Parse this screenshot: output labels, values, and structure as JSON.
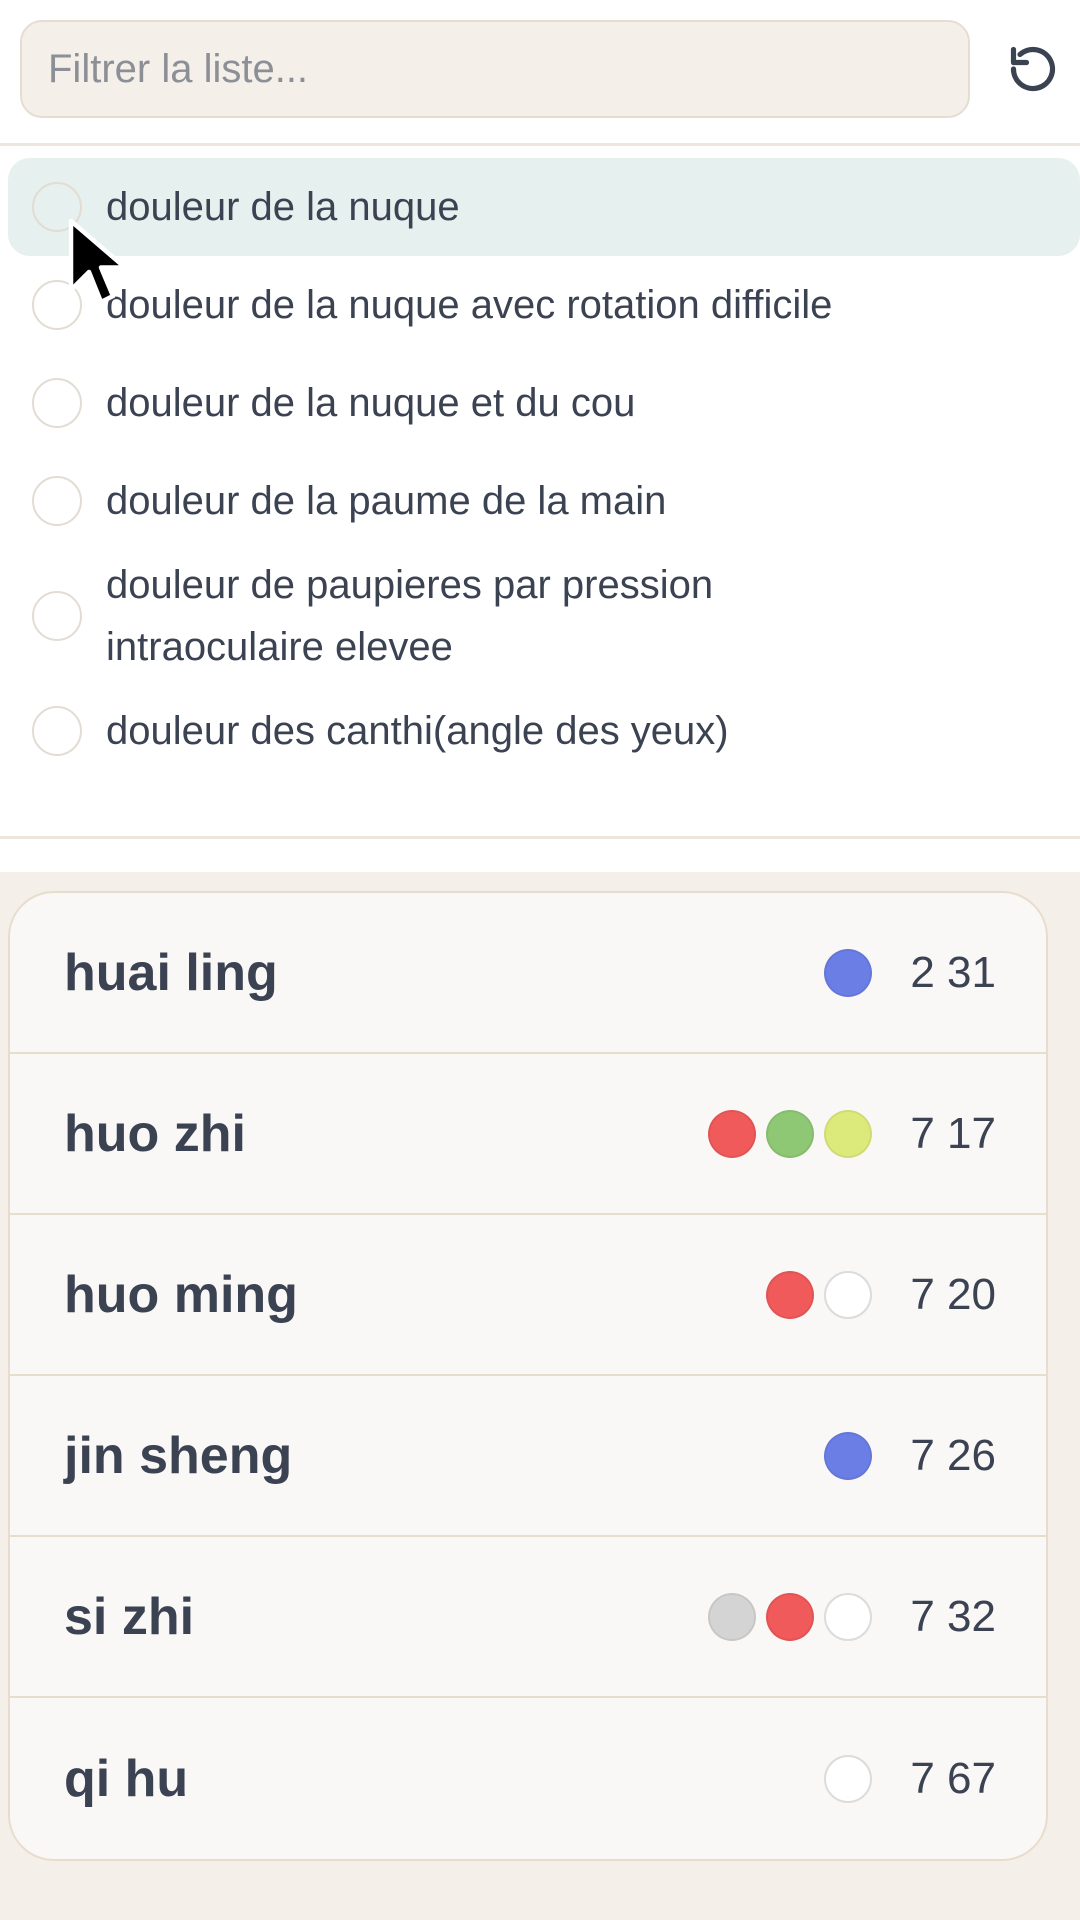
{
  "filter": {
    "placeholder": "Filtrer la liste...",
    "value": ""
  },
  "reset_button": {
    "icon": "rotate-ccw-icon"
  },
  "options": [
    {
      "label": "douleur de la nuque",
      "selected": true
    },
    {
      "label": "douleur de la nuque avec rotation difficile",
      "selected": false
    },
    {
      "label": "douleur de la nuque et du cou",
      "selected": false
    },
    {
      "label": "douleur de la paume de la main",
      "selected": false
    },
    {
      "label": "douleur de paupieres par pression intraoculaire elevee",
      "selected": false
    },
    {
      "label": "douleur des canthi(angle des yeux)",
      "selected": false
    }
  ],
  "results": [
    {
      "name": "huai ling",
      "num": "2 31",
      "dots": [
        "#6b7ee6"
      ]
    },
    {
      "name": "huo zhi",
      "num": "7 17",
      "dots": [
        "#f05a5a",
        "#8ec874",
        "#dcea7c"
      ]
    },
    {
      "name": "huo ming",
      "num": "7 20",
      "dots": [
        "#f05a5a",
        "#ffffff"
      ]
    },
    {
      "name": "jin sheng",
      "num": "7 26",
      "dots": [
        "#6b7ee6"
      ]
    },
    {
      "name": "si zhi",
      "num": "7 32",
      "dots": [
        "#d4d4d4",
        "#f05a5a",
        "#ffffff"
      ]
    },
    {
      "name": "qi hu",
      "num": "7 67",
      "dots": [
        "#ffffff"
      ]
    }
  ],
  "colors": {
    "accent_selected_bg": "#e6f0ee",
    "input_bg": "#f4efe9",
    "text": "#3b4252"
  }
}
